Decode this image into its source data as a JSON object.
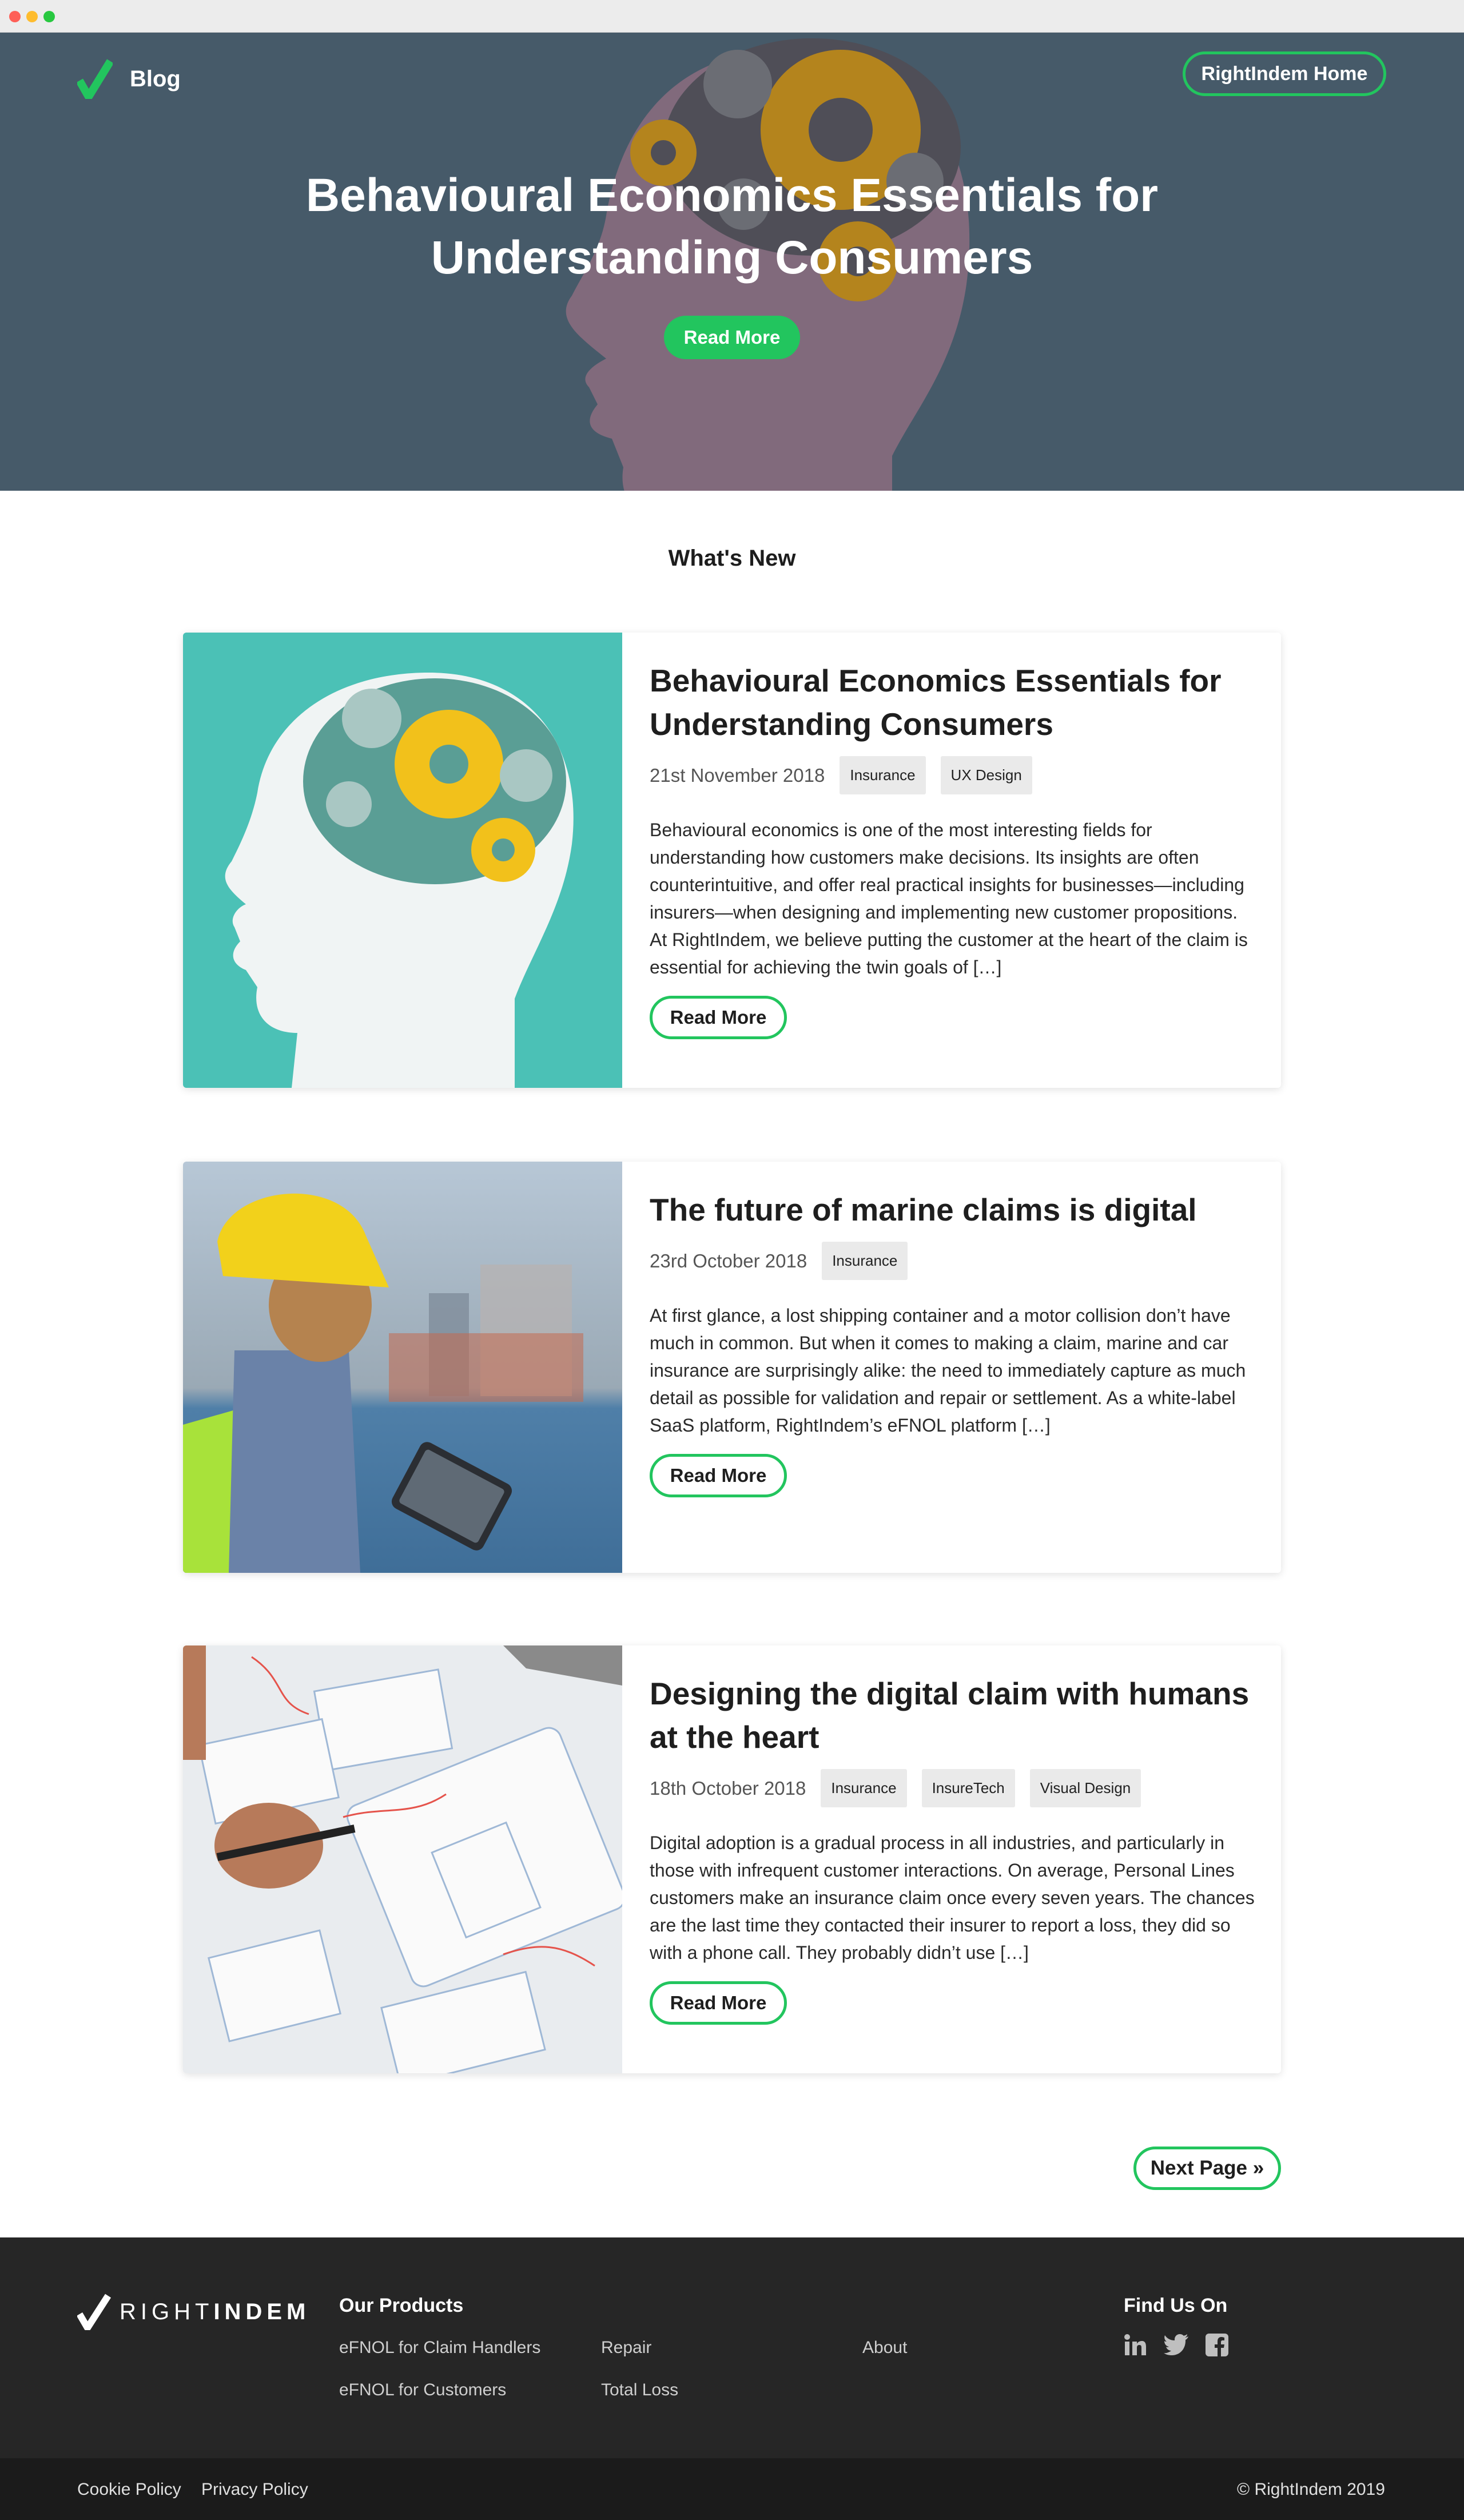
{
  "header": {
    "brand_label": "Blog",
    "home_button": "RightIndem Home"
  },
  "hero": {
    "title": "Behavioural Economics Essentials for Understanding Consumers",
    "cta": "Read More"
  },
  "section": {
    "title": "What's New"
  },
  "posts": [
    {
      "title": "Behavioural Economics Essentials for Understanding Consumers",
      "date": "21st November 2018",
      "tags": [
        "Insurance",
        "UX Design"
      ],
      "excerpt": "Behavioural economics is one of the most interesting fields for understanding how customers make decisions. Its insights are often counterintuitive, and offer real practical insights for businesses—including insurers—when designing and implementing new customer propositions. At RightIndem, we believe putting the customer at the heart of the claim is essential for achieving the twin goals of […]",
      "cta": "Read More"
    },
    {
      "title": "The future of marine claims is digital",
      "date": "23rd October 2018",
      "tags": [
        "Insurance"
      ],
      "excerpt": "At first glance, a lost shipping container and a motor collision don’t have much in common. But when it comes to making a claim, marine and car insurance are surprisingly alike: the need to immediately capture as much detail as possible for validation and repair or settlement. As a white-label SaaS platform, RightIndem’s eFNOL platform […]",
      "cta": "Read More"
    },
    {
      "title": "Designing the digital claim with humans at the heart",
      "date": "18th October 2018",
      "tags": [
        "Insurance",
        "InsureTech",
        "Visual Design"
      ],
      "excerpt": "Digital adoption is a gradual process in all industries, and particularly in those with infrequent customer interactions. On average, Personal Lines customers make an insurance claim once every seven years. The chances are the last time they contacted their insurer to report a loss, they did so with a phone call. They probably didn’t use […]",
      "cta": "Read More"
    }
  ],
  "pagination": {
    "next": "Next Page »"
  },
  "footer": {
    "logo_text_light": "RIGHT",
    "logo_text_bold": "INDEM",
    "products_heading": "Our Products",
    "links": [
      "eFNOL for Claim Handlers",
      "Repair",
      "About",
      "eFNOL for Customers",
      "Total Loss"
    ],
    "social_heading": "Find Us On",
    "social_icons": [
      "linkedin-icon",
      "twitter-icon",
      "facebook-icon"
    ],
    "cookie": "Cookie Policy",
    "privacy": "Privacy Policy",
    "copyright": "© RightIndem 2019"
  },
  "colors": {
    "accent": "#22c55e",
    "hero_bg": "#465a69",
    "footer_bg": "#262626",
    "card1_bg": "#4bc1b6"
  }
}
